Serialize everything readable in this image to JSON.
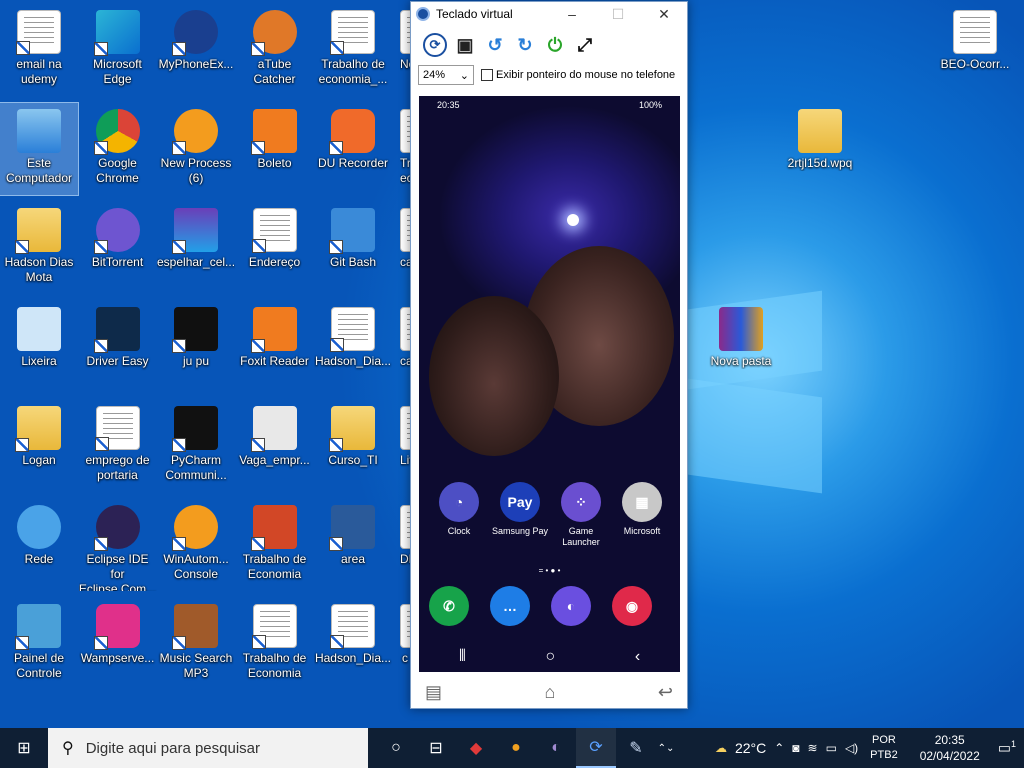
{
  "desktop": {
    "icons": [
      {
        "label": "email na\nudemy",
        "icon": "document-icon",
        "style": "doc"
      },
      {
        "label": "Microsoft\nEdge",
        "icon": "edge-icon",
        "style": "edge"
      },
      {
        "label": "MyPhoneEx...",
        "icon": "myphoneexplorer-icon",
        "style": "mpe"
      },
      {
        "label": "aTube\nCatcher",
        "icon": "atube-icon",
        "style": "atube"
      },
      {
        "label": "Trabalho de\neconomia_...",
        "icon": "document-icon",
        "style": "doc"
      },
      {
        "label": "Ne",
        "icon": "partial-icon",
        "style": "part"
      },
      {
        "label": "Este\nComputador",
        "icon": "computer-icon",
        "style": "pc"
      },
      {
        "label": "Google\nChrome",
        "icon": "chrome-icon",
        "style": "chrome"
      },
      {
        "label": "New Process\n(6)",
        "icon": "winautomation-icon",
        "style": "wa"
      },
      {
        "label": "Boleto",
        "icon": "pdf-icon",
        "style": "pdf"
      },
      {
        "label": "DU Recorder",
        "icon": "recorder-icon",
        "style": "du"
      },
      {
        "label": "Tra\nec",
        "icon": "partial-icon",
        "style": "part"
      },
      {
        "label": "Hadson Dias\nMota",
        "icon": "folder-icon",
        "style": "folder"
      },
      {
        "label": "BitTorrent",
        "icon": "bittorrent-icon",
        "style": "bt"
      },
      {
        "label": "espelhar_cel...",
        "icon": "screenshot-icon",
        "style": "shot"
      },
      {
        "label": "Endereço",
        "icon": "document-icon",
        "style": "doc"
      },
      {
        "label": "Git Bash",
        "icon": "git-icon",
        "style": "git"
      },
      {
        "label": "cap",
        "icon": "partial-icon",
        "style": "part"
      },
      {
        "label": "Lixeira",
        "icon": "recycle-bin-icon",
        "style": "bin"
      },
      {
        "label": "Driver Easy",
        "icon": "drivereasy-icon",
        "style": "de"
      },
      {
        "label": "ju pu",
        "icon": "screenshot-icon",
        "style": "dark"
      },
      {
        "label": "Foxit Reader",
        "icon": "foxit-icon",
        "style": "pdf"
      },
      {
        "label": "Hadson_Dia...",
        "icon": "document-icon",
        "style": "doc"
      },
      {
        "label": "cap",
        "icon": "partial-icon",
        "style": "part"
      },
      {
        "label": "Logan",
        "icon": "user-folder-icon",
        "style": "folder"
      },
      {
        "label": "emprego de\nportaria",
        "icon": "text-file-icon",
        "style": "doc"
      },
      {
        "label": "PyCharm\nCommuni...",
        "icon": "pycharm-icon",
        "style": "pyc"
      },
      {
        "label": "Vaga_empr...",
        "icon": "screenshot-icon",
        "style": "vaga"
      },
      {
        "label": "Curso_TI",
        "icon": "folder-icon",
        "style": "folder"
      },
      {
        "label": "Livr",
        "icon": "partial-icon",
        "style": "part"
      },
      {
        "label": "Rede",
        "icon": "network-icon",
        "style": "net"
      },
      {
        "label": "Eclipse IDE for\nEclipse Com...",
        "icon": "eclipse-icon",
        "style": "ecl"
      },
      {
        "label": "WinAutom...\nConsole",
        "icon": "winautomation-icon",
        "style": "wa"
      },
      {
        "label": "Trabalho de\nEconomia",
        "icon": "powerpoint-icon",
        "style": "ppt"
      },
      {
        "label": "area",
        "icon": "screenshot-icon",
        "style": "area"
      },
      {
        "label": "DB",
        "icon": "partial-icon",
        "style": "part"
      },
      {
        "label": "Painel de\nControle",
        "icon": "control-panel-icon",
        "style": "cp"
      },
      {
        "label": "Wampserve...",
        "icon": "wampserver-icon",
        "style": "wamp"
      },
      {
        "label": "Music Search\nMP3",
        "icon": "music-icon",
        "style": "mp3"
      },
      {
        "label": "Trabalho de\nEconomia",
        "icon": "flowchart-icon",
        "style": "doc"
      },
      {
        "label": "Hadson_Dia...",
        "icon": "document-icon",
        "style": "doc"
      },
      {
        "label": "c",
        "icon": "partial-icon",
        "style": "part"
      }
    ],
    "right_icons": [
      {
        "label": "BEO-Ocorr...",
        "icon": "document-icon"
      },
      {
        "label": "2rtjl15d.wpq",
        "icon": "folder-icon"
      },
      {
        "label": "Nova pasta",
        "icon": "winrar-icon"
      }
    ]
  },
  "window": {
    "title": "Teclado virtual",
    "minimize": "–",
    "maximize": "☐",
    "close": "✕",
    "toolbar": [
      "refresh-icon",
      "save-icon",
      "rotate-left-icon",
      "rotate-right-icon",
      "power-icon",
      "fullscreen-icon"
    ],
    "zoom": "24%",
    "checkbox_label": "Exibir ponteiro do mouse no telefone",
    "phone": {
      "time": "20:35",
      "battery": "100%",
      "apps": [
        {
          "label": "Clock",
          "color": "#4d4fc4",
          "glyph": "◔"
        },
        {
          "label": "Samsung Pay",
          "color": "#1d3fb8",
          "glyph": "Pay"
        },
        {
          "label": "Game\nLauncher",
          "color": "#6a4fd0",
          "glyph": "⁘"
        },
        {
          "label": "Microsoft",
          "color": "#c8c8c8",
          "glyph": "▦"
        }
      ],
      "dock": [
        {
          "name": "phone-app-icon",
          "color": "#17a34a",
          "glyph": "✆"
        },
        {
          "name": "messages-app-icon",
          "color": "#1e7de6",
          "glyph": "…"
        },
        {
          "name": "internet-app-icon",
          "color": "#6a4fe0",
          "glyph": "◐"
        },
        {
          "name": "camera-app-icon",
          "color": "#e0294a",
          "glyph": "◉"
        }
      ]
    }
  },
  "taskbar": {
    "search_placeholder": "Digite aqui para pesquisar",
    "weather": "22°C",
    "lang1": "POR",
    "lang2": "PTB2",
    "time": "20:35",
    "date": "02/04/2022",
    "notifications": "1"
  }
}
